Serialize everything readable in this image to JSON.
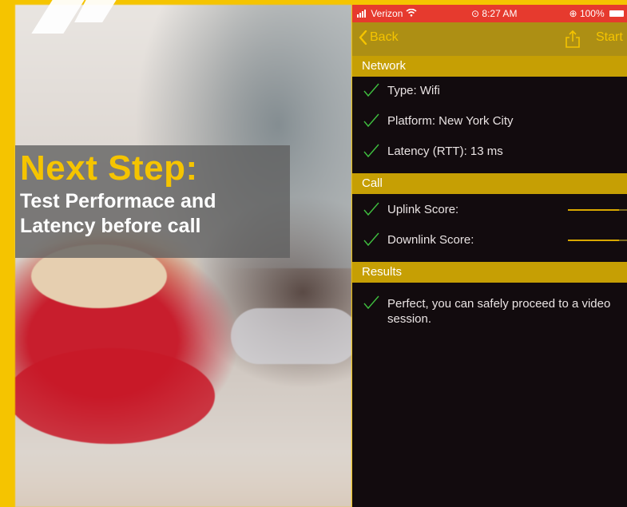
{
  "promo": {
    "heading": "Next Step:",
    "subline1": "Test Performace and",
    "subline2": "Latency before call"
  },
  "status_bar": {
    "carrier": "Verizon",
    "time": "8:27 AM",
    "battery": "100%"
  },
  "nav": {
    "back_label": "Back",
    "start_label": "Start"
  },
  "sections": {
    "network": "Network",
    "call": "Call",
    "results": "Results"
  },
  "network_rows": [
    {
      "label": "Type: Wifi"
    },
    {
      "label": "Platform: New York City"
    },
    {
      "label": "Latency (RTT): 13 ms"
    }
  ],
  "call_rows": [
    {
      "label": "Uplink Score:"
    },
    {
      "label": "Downlink Score:"
    }
  ],
  "result_text": "Perfect, you can safely proceed to a video session.",
  "colors": {
    "brand_yellow": "#f5c400",
    "section_bar": "#c69f04",
    "nav_bar": "#ad8f14",
    "status_bar": "#e63a2e",
    "check_green": "#3fbf3f",
    "panel_bg": "#120b0e"
  }
}
